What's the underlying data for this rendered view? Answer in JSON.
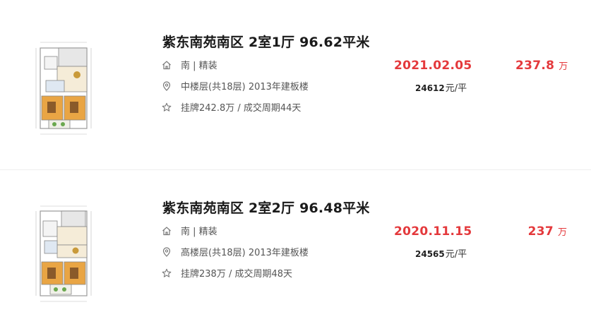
{
  "listings": [
    {
      "title": "紫东南苑南区 2室1厅 96.62平米",
      "orientation_decoration": "南 | 精装",
      "floor_info": "中楼层(共18层) 2013年建板楼",
      "listing_info": "挂牌242.8万 / 成交周期44天",
      "deal_date": "2021.02.05",
      "total_price": "237.8",
      "total_price_unit": "万",
      "unit_price": "24612",
      "unit_price_unit": "元/平"
    },
    {
      "title": "紫东南苑南区 2室2厅 96.48平米",
      "orientation_decoration": "南 | 精装",
      "floor_info": "高楼层(共18层) 2013年建板楼",
      "listing_info": "挂牌238万 / 成交周期48天",
      "deal_date": "2020.11.15",
      "total_price": "237",
      "total_price_unit": "万",
      "unit_price": "24565",
      "unit_price_unit": "元/平"
    }
  ],
  "icons": [
    "house-icon",
    "location-pin-icon",
    "star-icon"
  ],
  "colors": {
    "accent": "#e4393c",
    "title": "#1a1a1a",
    "meta": "#555555"
  }
}
